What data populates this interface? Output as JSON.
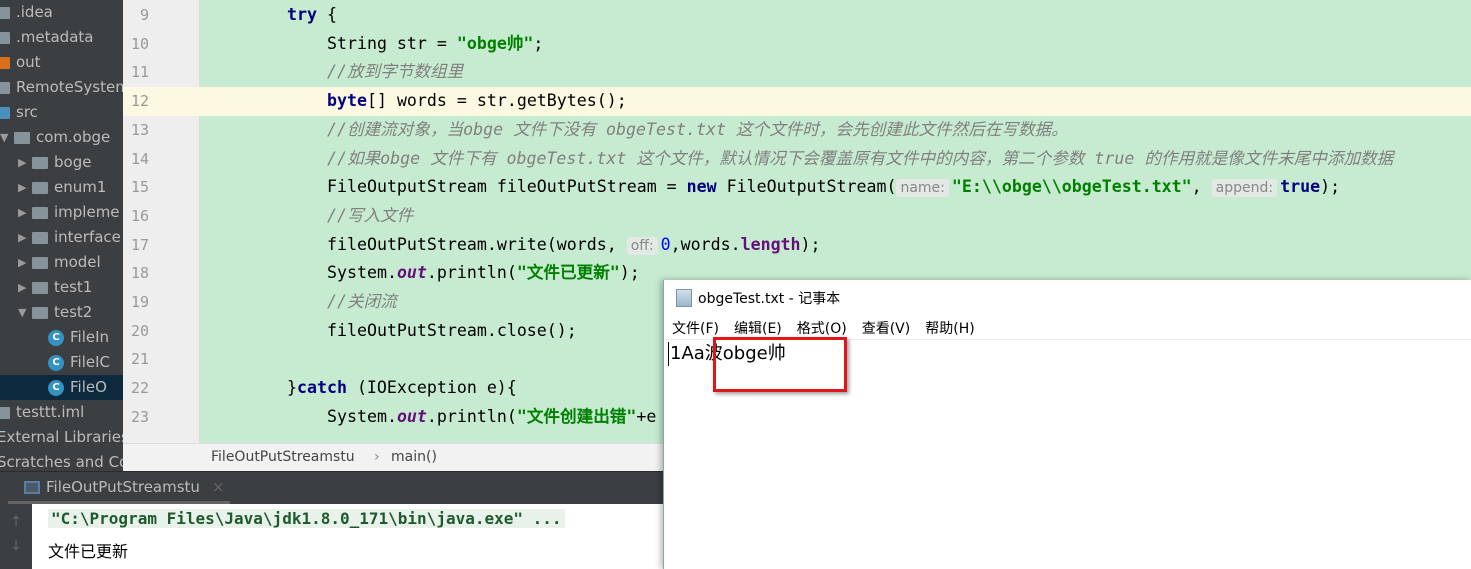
{
  "project_tree": [
    {
      "label": ".idea",
      "indent": 0,
      "type": "folder"
    },
    {
      "label": ".metadata",
      "indent": 0,
      "type": "folder"
    },
    {
      "label": "out",
      "indent": 0,
      "type": "folder-out"
    },
    {
      "label": "RemoteSystem",
      "indent": 0,
      "type": "folder"
    },
    {
      "label": "src",
      "indent": 0,
      "type": "folder-src"
    },
    {
      "label": "com.obge",
      "indent": 1,
      "type": "package",
      "arrow": "▼"
    },
    {
      "label": "boge",
      "indent": 2,
      "type": "package",
      "arrow": "▶"
    },
    {
      "label": "enum1",
      "indent": 2,
      "type": "package",
      "arrow": "▶"
    },
    {
      "label": "impleme",
      "indent": 2,
      "type": "package",
      "arrow": "▶"
    },
    {
      "label": "interface",
      "indent": 2,
      "type": "package",
      "arrow": "▶"
    },
    {
      "label": "model",
      "indent": 2,
      "type": "package",
      "arrow": "▶"
    },
    {
      "label": "test1",
      "indent": 2,
      "type": "package",
      "arrow": "▶"
    },
    {
      "label": "test2",
      "indent": 2,
      "type": "package",
      "arrow": "▼"
    },
    {
      "label": "FileIn",
      "indent": 3,
      "type": "class"
    },
    {
      "label": "FileIC",
      "indent": 3,
      "type": "class"
    },
    {
      "label": "FileO",
      "indent": 3,
      "type": "class",
      "selected": true
    },
    {
      "label": "testtt.iml",
      "indent": 0,
      "type": "file"
    },
    {
      "label": "External Libraries",
      "indent": -1,
      "type": "none"
    },
    {
      "label": "Scratches and Con",
      "indent": -1,
      "type": "none"
    }
  ],
  "editor": {
    "current_line": 12,
    "lines": [
      {
        "n": "9",
        "indent": 1,
        "tokens": [
          [
            "try",
            "kw"
          ],
          [
            " {",
            ""
          ]
        ]
      },
      {
        "n": "10",
        "indent": 2,
        "tokens": [
          [
            "String str = ",
            ""
          ],
          [
            "\"obge帅\"",
            "str"
          ],
          [
            ";",
            ""
          ]
        ]
      },
      {
        "n": "11",
        "indent": 2,
        "tokens": [
          [
            "//放到字节数组里",
            "cm"
          ]
        ]
      },
      {
        "n": "12",
        "indent": 2,
        "tokens": [
          [
            "byte",
            "kw"
          ],
          [
            "[] words = str.getBytes();",
            ""
          ]
        ]
      },
      {
        "n": "13",
        "indent": 2,
        "tokens": [
          [
            "//创建流对象，当obge 文件下没有 obgeTest.txt 这个文件时，会先创建此文件然后在写数据。",
            "cm"
          ]
        ]
      },
      {
        "n": "14",
        "indent": 2,
        "tokens": [
          [
            "//如果obge 文件下有 obgeTest.txt 这个文件，默认情况下会覆盖原有文件中的内容，第二个参数 true 的作用就是像文件末尾中添加数据",
            "cm"
          ]
        ]
      },
      {
        "n": "15",
        "indent": 2,
        "tokens": [
          [
            "FileOutputStream fileOutPutStream = ",
            ""
          ],
          [
            "new",
            "kw"
          ],
          [
            " FileOutputStream(",
            ""
          ],
          [
            "name:",
            "hint"
          ],
          [
            "\"E:\\\\obge\\\\obgeTest.txt\"",
            "str"
          ],
          [
            ", ",
            ""
          ],
          [
            "append:",
            "hint"
          ],
          [
            "true",
            "kw"
          ],
          [
            ");",
            ""
          ]
        ]
      },
      {
        "n": "16",
        "indent": 2,
        "tokens": [
          [
            "//写入文件",
            "cm"
          ]
        ]
      },
      {
        "n": "17",
        "indent": 2,
        "tokens": [
          [
            "fileOutPutStream.write(words, ",
            ""
          ],
          [
            "off:",
            "hint"
          ],
          [
            "0",
            "num"
          ],
          [
            ",words.",
            ""
          ],
          [
            "length",
            "mem"
          ],
          [
            ");",
            ""
          ]
        ]
      },
      {
        "n": "18",
        "indent": 2,
        "tokens": [
          [
            "System.",
            ""
          ],
          [
            "out",
            "fld"
          ],
          [
            ".println(",
            ""
          ],
          [
            "\"文件已更新\"",
            "str"
          ],
          [
            ");",
            ""
          ]
        ]
      },
      {
        "n": "19",
        "indent": 2,
        "tokens": [
          [
            "//关闭流",
            "cm"
          ]
        ]
      },
      {
        "n": "20",
        "indent": 2,
        "tokens": [
          [
            "fileOutPutStream.close();",
            ""
          ]
        ]
      },
      {
        "n": "21",
        "indent": 2,
        "tokens": []
      },
      {
        "n": "22",
        "indent": 1,
        "tokens": [
          [
            "}",
            ""
          ],
          [
            "catch",
            "kw"
          ],
          [
            " (IOException e){",
            ""
          ]
        ]
      },
      {
        "n": "23",
        "indent": 2,
        "tokens": [
          [
            "System.",
            ""
          ],
          [
            "out",
            "fld"
          ],
          [
            ".println(",
            ""
          ],
          [
            "\"文件创建出错\"",
            "str"
          ],
          [
            "+e",
            ""
          ]
        ]
      }
    ]
  },
  "breadcrumb": {
    "class": "FileOutPutStreamstu",
    "separator": "›",
    "method": "main()"
  },
  "run_panel": {
    "tab_label": "FileOutPutStreamstu",
    "close": "×",
    "console_lines": [
      "\"C:\\Program Files\\Java\\jdk1.8.0_171\\bin\\java.exe\" ...",
      "文件已更新"
    ],
    "up_arrow": "↑",
    "down_arrow": "↓"
  },
  "notepad": {
    "title": "obgeTest.txt - 记事本",
    "menu": [
      "文件(F)",
      "编辑(E)",
      "格式(O)",
      "查看(V)",
      "帮助(H)"
    ],
    "content": "1Aa波obge帅",
    "highlight_color": "#e0161a"
  }
}
